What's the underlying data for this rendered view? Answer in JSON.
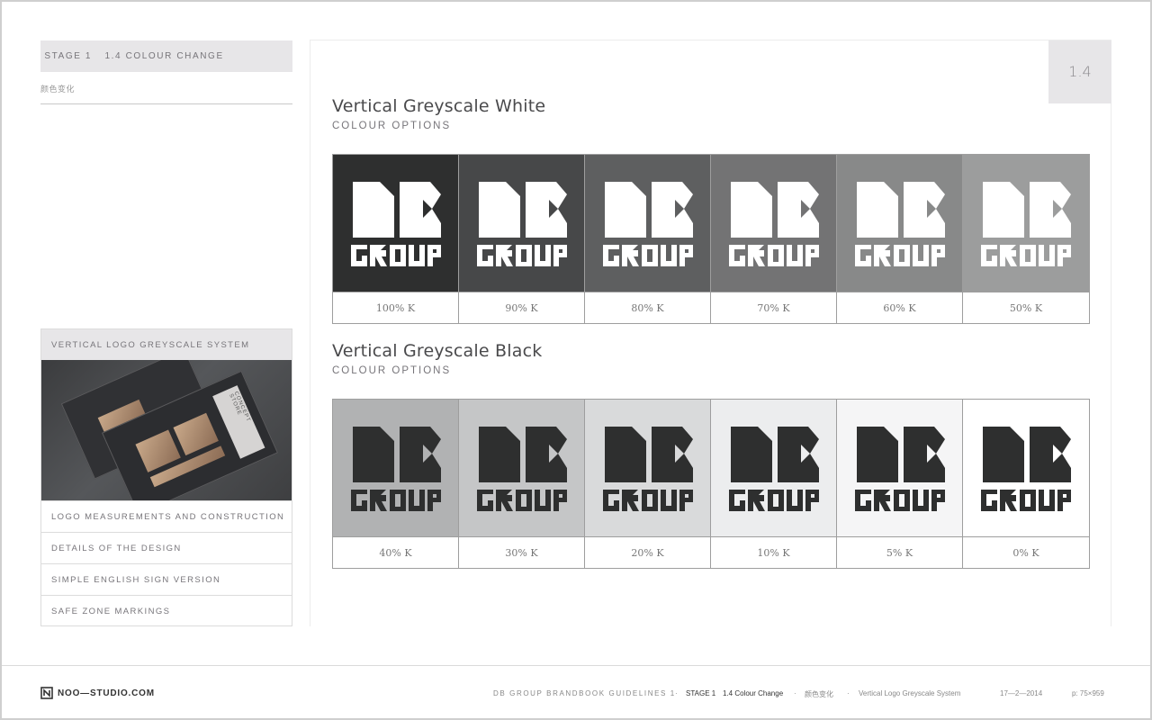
{
  "left": {
    "stage_label": "STAGE 1",
    "section_label": "1.4 COLOUR CHANGE",
    "subtitle_cn": "颜色变化",
    "panel_title": "VERTICAL LOGO GREYSCALE SYSTEM",
    "photo_card_text": "CONCEPT STORE",
    "items": [
      "LOGO MEASUREMENTS AND CONSTRUCTION",
      "DETAILS OF THE DESIGN",
      "SIMPLE ENGLISH SIGN VERSION",
      "SAFE ZONE MARKINGS"
    ]
  },
  "main": {
    "page_number": "1.4",
    "white": {
      "title": "Vertical Greyscale White",
      "subtitle": "COLOUR OPTIONS",
      "swatches": [
        {
          "label": "100% K",
          "bg": "#2e2f2f",
          "logo": "#ffffff"
        },
        {
          "label": "90% K",
          "bg": "#474849",
          "logo": "#ffffff"
        },
        {
          "label": "80% K",
          "bg": "#5e5f60",
          "logo": "#ffffff"
        },
        {
          "label": "70% K",
          "bg": "#737374",
          "logo": "#ffffff"
        },
        {
          "label": "60% K",
          "bg": "#888989",
          "logo": "#ffffff"
        },
        {
          "label": "50% K",
          "bg": "#9c9d9d",
          "logo": "#ffffff"
        }
      ]
    },
    "black": {
      "title": "Vertical Greyscale Black",
      "subtitle": "COLOUR OPTIONS",
      "swatches": [
        {
          "label": "40% K",
          "bg": "#b1b2b3",
          "logo": "#2e2f2f"
        },
        {
          "label": "30% K",
          "bg": "#c5c6c7",
          "logo": "#2e2f2f"
        },
        {
          "label": "20% K",
          "bg": "#d9dadb",
          "logo": "#2e2f2f"
        },
        {
          "label": "10% K",
          "bg": "#ecedee",
          "logo": "#2e2f2f"
        },
        {
          "label": "5% K",
          "bg": "#f5f5f6",
          "logo": "#2e2f2f"
        },
        {
          "label": "0% K",
          "bg": "#ffffff",
          "logo": "#2e2f2f"
        }
      ]
    }
  },
  "footer": {
    "brand": "NOO—STUDIO.COM",
    "guide": "DB GROUP BRANDBOOK GUIDELINES 1",
    "stage": "STAGE 1",
    "section": "1.4 Colour Change",
    "section_cn": "颜色变化",
    "topic": "Vertical Logo Greyscale System",
    "date": "17—2—2014",
    "page": "p: 75×959"
  }
}
